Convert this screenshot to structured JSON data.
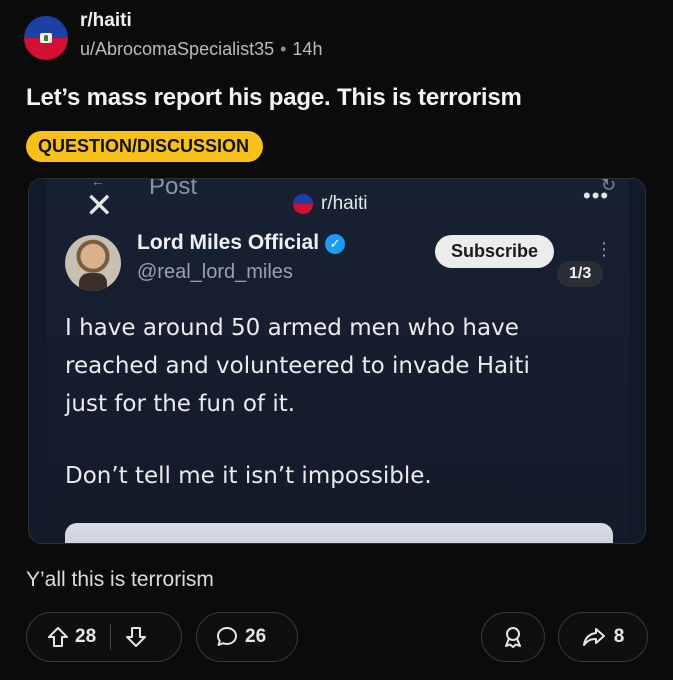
{
  "header": {
    "subreddit": "r/haiti",
    "author": "u/AbrocomaSpecialist35",
    "separator": "•",
    "age": "14h"
  },
  "post": {
    "title": "Let’s mass report his page. This is terrorism",
    "flair": "QUESTION/DISCUSSION",
    "flair_color": "#f7c11a",
    "body": "Y’all this is terrorism"
  },
  "embedded_screenshot": {
    "post_label": "Post",
    "subreddit": "r/haiti",
    "author_name": "Lord Miles Official",
    "author_handle": "@real_lord_miles",
    "verified_icon": "verified-check-icon",
    "subscribe_label": "Subscribe",
    "page_indicator": "1/3",
    "text_lines": [
      "I have around 50 armed men who have",
      "reached and volunteered to invade Haiti",
      "just for the fun of it."
    ],
    "text_para2": "Don’t tell me it isn’t impossible.",
    "more_icon": "•••"
  },
  "actions": {
    "upvotes": "28",
    "comments": "26",
    "shares": "8"
  }
}
